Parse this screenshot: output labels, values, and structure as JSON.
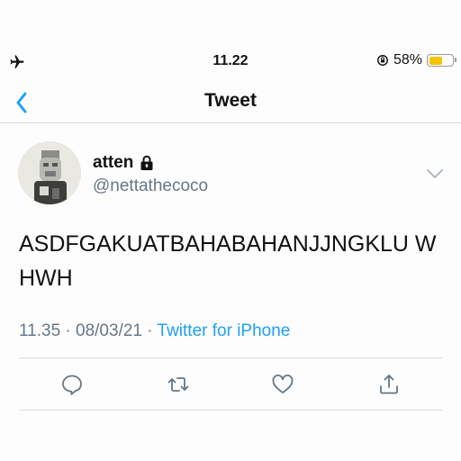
{
  "status_bar": {
    "time": "11.22",
    "battery_percent": "58%",
    "battery_level": 0.58,
    "airplane_icon": "airplane-icon",
    "rotation_lock_icon": "rotation-lock-icon",
    "battery_color": "#f5c400"
  },
  "nav": {
    "title": "Tweet",
    "back_icon": "chevron-left-icon"
  },
  "tweet": {
    "display_name": "atten",
    "protected_icon": "lock-icon",
    "username": "@nettathecoco",
    "text": "ASDFGAKUATBAHABAHANJJNGKLU WHWH",
    "timestamp": "11.35 · 08/03/21 · ",
    "source": "Twitter for iPhone",
    "more_icon": "chevron-down-icon"
  },
  "actions": [
    {
      "name": "reply",
      "icon": "reply-icon"
    },
    {
      "name": "retweet",
      "icon": "retweet-icon"
    },
    {
      "name": "like",
      "icon": "heart-icon"
    },
    {
      "name": "share",
      "icon": "share-icon"
    }
  ],
  "colors": {
    "accent": "#1da1f2",
    "secondary_text": "#657786",
    "divider": "#dcdcdc"
  }
}
